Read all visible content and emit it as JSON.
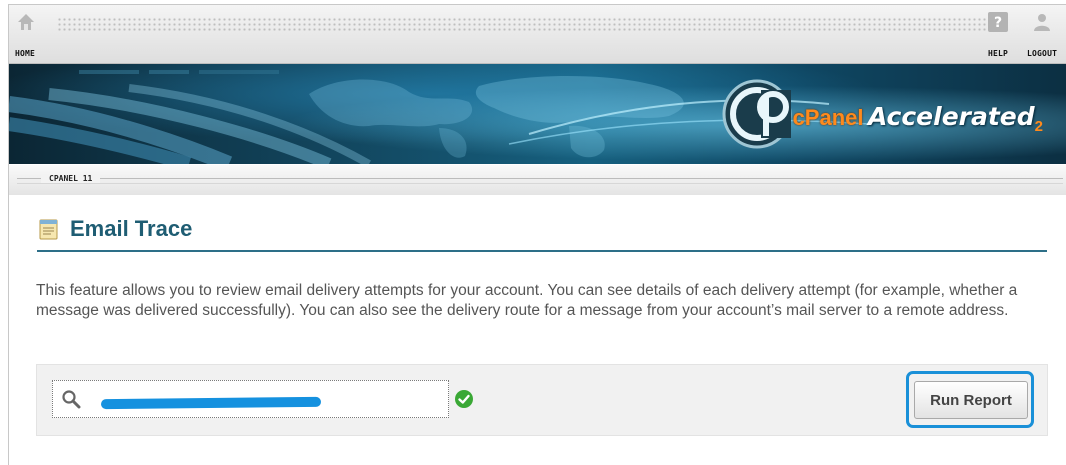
{
  "topnav": {
    "home_label": "HOME",
    "help_label": "HELP",
    "logout_label": "LOGOUT"
  },
  "banner": {
    "logo_text": "cP",
    "brand_cpanel": "cPanel",
    "brand_accelerated": "Accelerated",
    "brand_version": "2"
  },
  "breadcrumb": {
    "label": "CPANEL 11"
  },
  "page": {
    "title": "Email Trace",
    "description": "This feature allows you to review email delivery attempts for your account. You can see details of each delivery attempt (for example, whether a message was delivered successfully). You can also see the delivery route for a message from your account’s mail server to a remote address."
  },
  "form": {
    "search_value": "",
    "run_report_label": "Run Report"
  },
  "colors": {
    "title": "#1f5d73",
    "rule": "#2d6f88",
    "highlight": "#1a90d8",
    "check": "#3aa835",
    "brand_orange": "#ff8a1c"
  },
  "icons": {
    "home": "home-icon",
    "help": "help-icon",
    "logout": "logout-icon",
    "title": "notepad-icon",
    "search": "magnifier-icon",
    "status": "check-circle-icon"
  }
}
